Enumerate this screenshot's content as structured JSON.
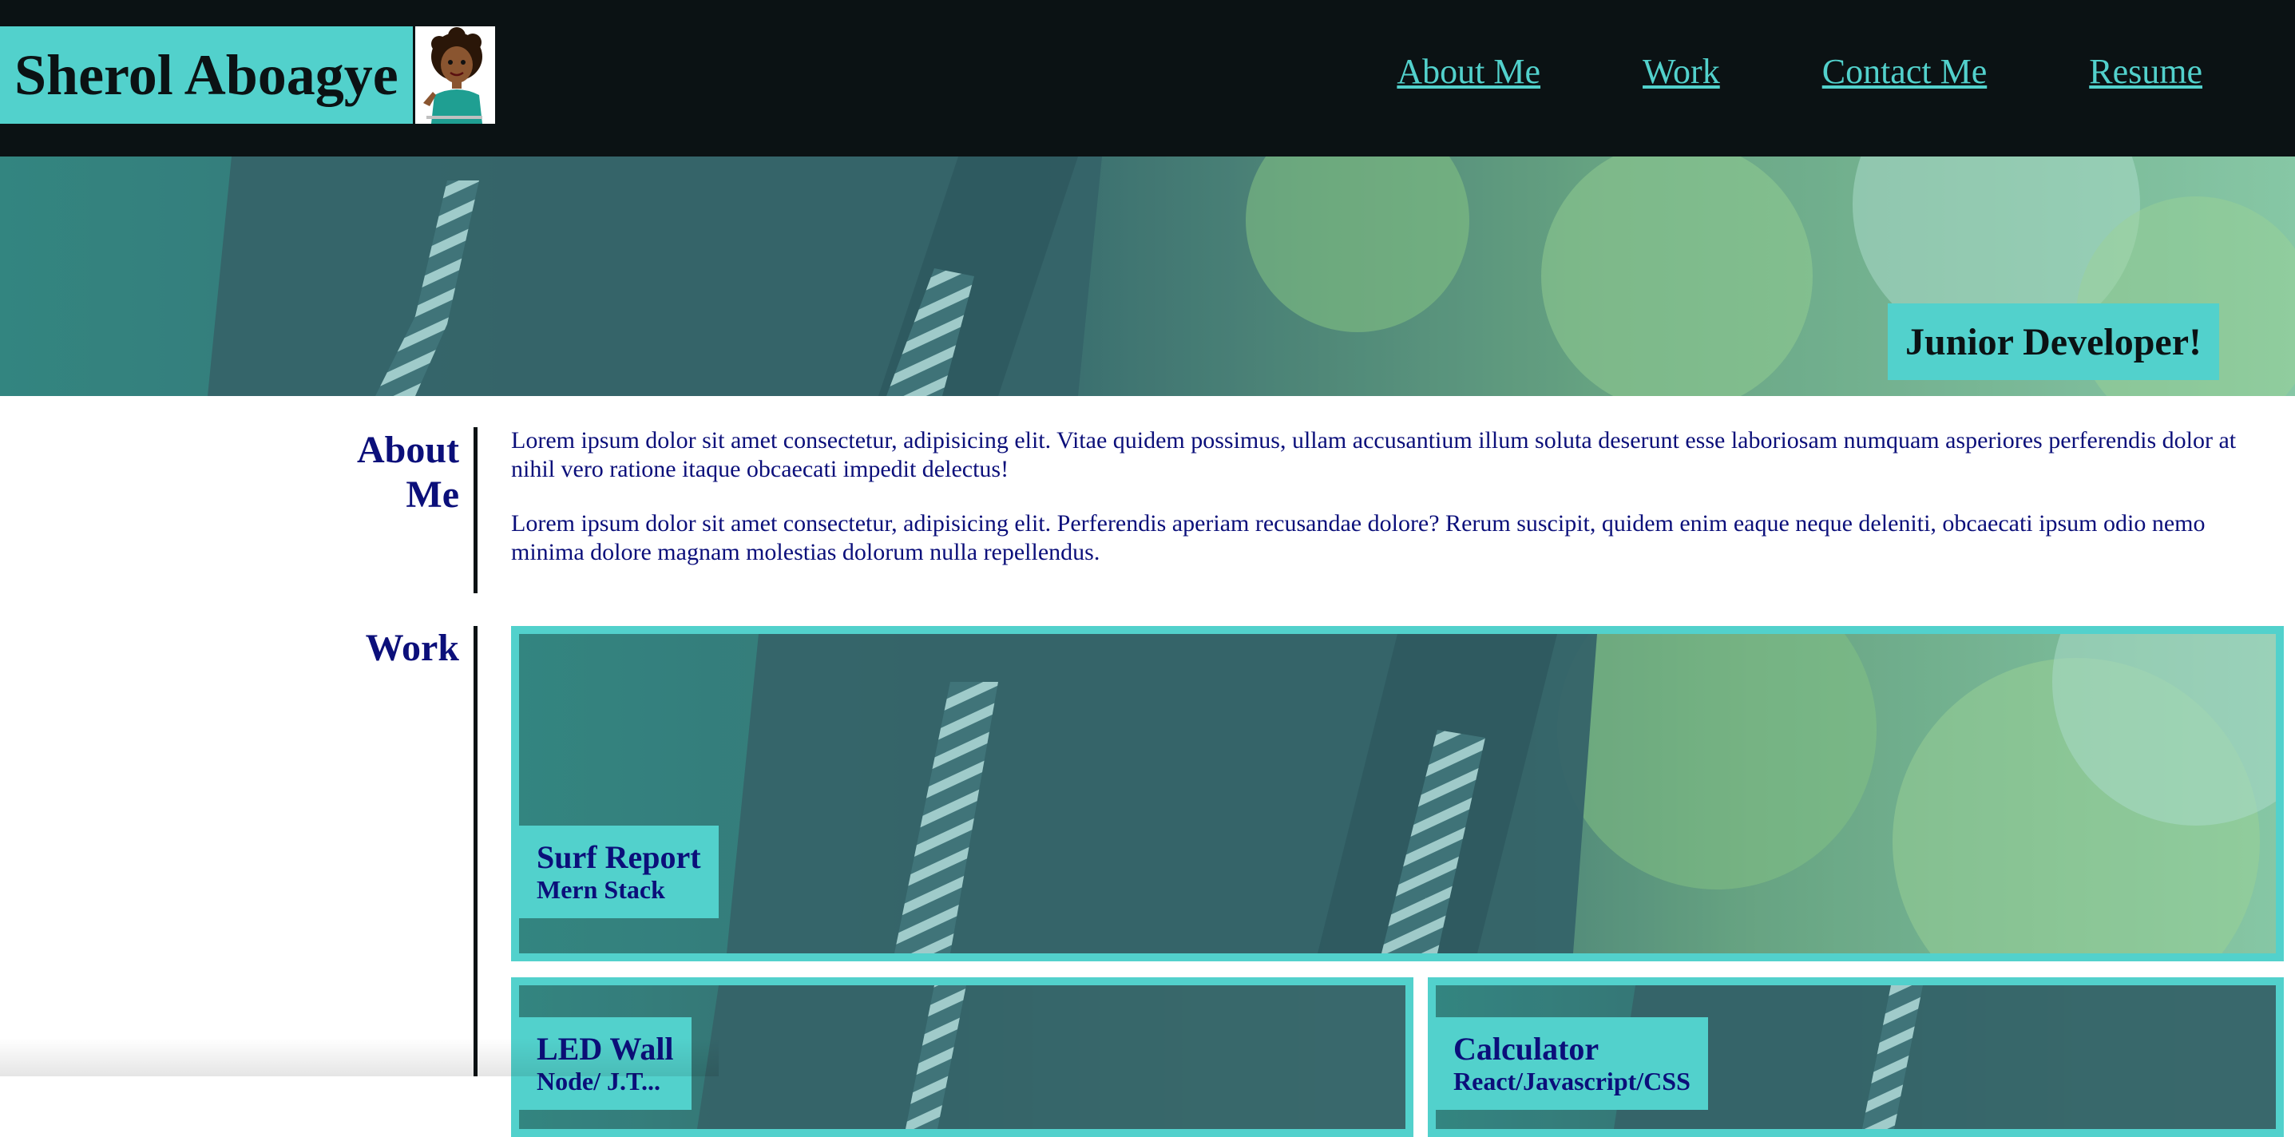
{
  "header": {
    "name": "Sherol Aboagye",
    "avatar_icon": "cartoon-woman-avatar",
    "nav": [
      {
        "label": "About Me"
      },
      {
        "label": "Work"
      },
      {
        "label": "Contact Me"
      },
      {
        "label": "Resume"
      }
    ]
  },
  "hero": {
    "tagline": "Junior Developer!"
  },
  "about": {
    "title_line1": "About",
    "title_line2": "Me",
    "paragraphs": [
      "Lorem ipsum dolor sit amet consectetur, adipisicing elit. Vitae quidem possimus, ullam accusantium illum soluta deserunt esse laboriosam numquam asperiores perferendis dolor at nihil vero ratione itaque obcaecati impedit delectus!",
      "Lorem ipsum dolor sit amet consectetur, adipisicing elit. Perferendis aperiam recusandae dolore? Rerum suscipit, quidem enim eaque neque deleniti, obcaecati ipsum odio nemo minima dolore magnam molestias dolorum nulla repellendus."
    ]
  },
  "work": {
    "title": "Work",
    "projects": [
      {
        "title": "Surf Report",
        "subtitle": "Mern Stack"
      },
      {
        "title": "LED Wall",
        "subtitle": "Node/ J.T..."
      },
      {
        "title": "Calculator",
        "subtitle": "React/Javascript/CSS"
      }
    ]
  },
  "colors": {
    "accent": "#52d1cc",
    "header_bg": "#0b1214",
    "text_blue": "#0b0f7a"
  }
}
